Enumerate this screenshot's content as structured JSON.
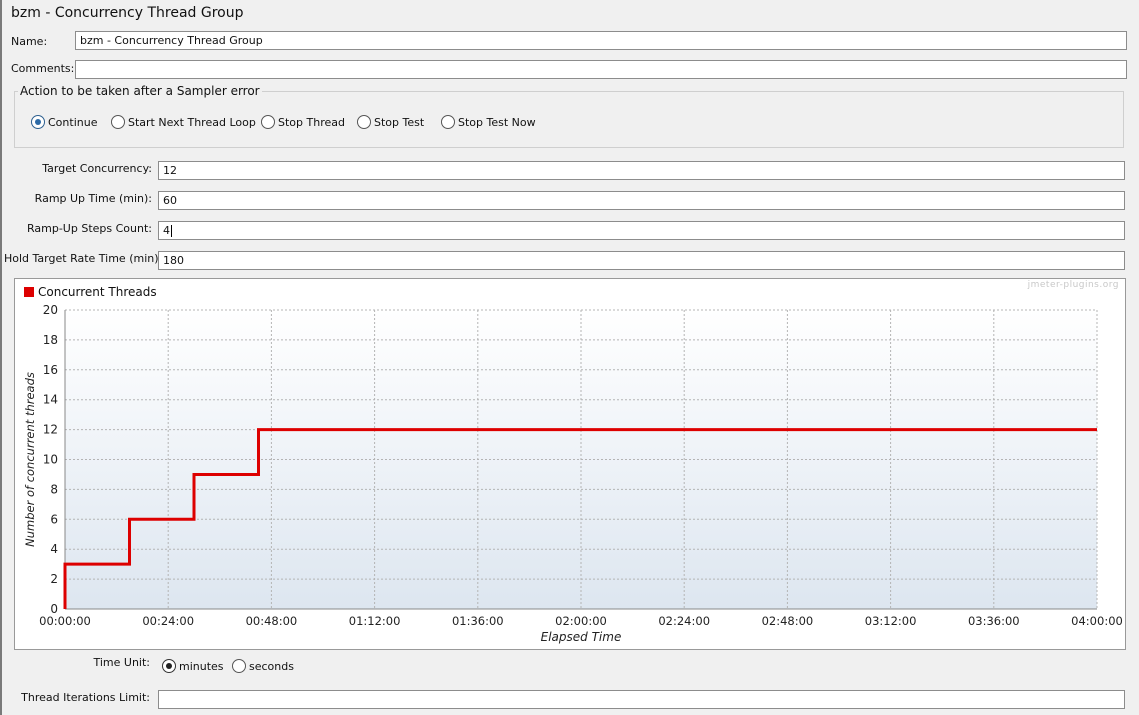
{
  "window_title": "bzm - Concurrency Thread Group",
  "name_field": {
    "label": "Name:",
    "value": "bzm - Concurrency Thread Group"
  },
  "comments_field": {
    "label": "Comments:",
    "value": ""
  },
  "sampler_error": {
    "legend": "Action to be taken after a Sampler error",
    "options": [
      "Continue",
      "Start Next Thread Loop",
      "Stop Thread",
      "Stop Test",
      "Stop Test Now"
    ],
    "selected": "Continue"
  },
  "params": {
    "target_concurrency": {
      "label": "Target Concurrency:",
      "value": "12"
    },
    "ramp_up_time": {
      "label": "Ramp Up Time (min):",
      "value": "60"
    },
    "ramp_up_steps": {
      "label": "Ramp-Up Steps Count:",
      "value": "4"
    },
    "hold_time": {
      "label": "Hold Target Rate Time (min):",
      "value": "180"
    }
  },
  "time_unit": {
    "label": "Time Unit:",
    "options": [
      "minutes",
      "seconds"
    ],
    "selected": "minutes"
  },
  "iterations": {
    "label": "Thread Iterations Limit:",
    "value": ""
  },
  "watermark": "jmeter-plugins.org",
  "chart_data": {
    "type": "line",
    "title": "",
    "xlabel": "Elapsed Time",
    "ylabel": "Number of concurrent threads",
    "x_unit": "minutes",
    "xlim": [
      0,
      240
    ],
    "ylim": [
      0,
      20
    ],
    "x_ticks": [
      0,
      24,
      48,
      72,
      96,
      120,
      144,
      168,
      192,
      216,
      240
    ],
    "x_tick_labels": [
      "00:00:00",
      "00:24:00",
      "00:48:00",
      "01:12:00",
      "01:36:00",
      "02:00:00",
      "02:24:00",
      "02:48:00",
      "03:12:00",
      "03:36:00",
      "04:00:00"
    ],
    "y_ticks": [
      0,
      2,
      4,
      6,
      8,
      10,
      12,
      14,
      16,
      18,
      20
    ],
    "grid": true,
    "legend_position": "top-left",
    "series": [
      {
        "name": "Concurrent Threads",
        "color": "#dd0000",
        "step": true,
        "points": [
          [
            0,
            0
          ],
          [
            0,
            3
          ],
          [
            15,
            3
          ],
          [
            15,
            6
          ],
          [
            30,
            6
          ],
          [
            30,
            9
          ],
          [
            45,
            9
          ],
          [
            45,
            12
          ],
          [
            240,
            12
          ]
        ]
      }
    ]
  }
}
